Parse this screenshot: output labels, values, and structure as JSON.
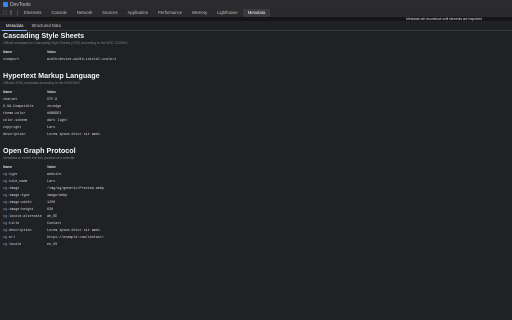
{
  "window": {
    "title": "DevTools"
  },
  "panel_tabs": [
    "Elements",
    "Console",
    "Network",
    "Sources",
    "Application",
    "Performance",
    "Memory",
    "Lighthouse",
    "Metadata"
  ],
  "active_panel_tab": "Metadata",
  "notice": "Metadata will reconstruct until elements are inspected",
  "subtabs": [
    "Metadata",
    "Structured Data"
  ],
  "active_subtab": "Metadata",
  "sections": {
    "css": {
      "title": "Cascading Style Sheets",
      "description": "Official metadata for Cascading Style Sheets (CSS) according to the W3C CSSWG.",
      "headers": [
        "Name",
        "Value"
      ],
      "rows": [
        {
          "name": "viewport",
          "value": "width=device-width,initial-scale=1"
        }
      ]
    },
    "html": {
      "title": "Hypertext Markup Language",
      "description": "Official HTML metadata according to the WHATWG.",
      "headers": [
        "Name",
        "Value"
      ],
      "rows": [
        {
          "name": "charset",
          "value": "UTF-8"
        },
        {
          "name": "X-UA-Compatible",
          "value": "ie=edge"
        },
        {
          "name": "theme-color",
          "value": "#6B8DE3"
        },
        {
          "name": "color-scheme",
          "value": "dark light"
        },
        {
          "name": "copyright",
          "value": "Lars"
        },
        {
          "name": "description",
          "value": "Lorem ipsum dolor sit amet."
        }
      ]
    },
    "og": {
      "title": "Open Graph Protocol",
      "description": "Metadata to enrich the link preview of a website.",
      "headers": [
        "Name",
        "Value"
      ],
      "prefix": "og:",
      "rows": [
        {
          "name": "type",
          "value": "website"
        },
        {
          "name": "site_name",
          "value": "Lars"
        },
        {
          "name": "image",
          "value": "/img/og/generic/Preview.webp"
        },
        {
          "name": "image:type",
          "value": "image/webp"
        },
        {
          "name": "image:width",
          "value": "1200"
        },
        {
          "name": "image:height",
          "value": "630"
        },
        {
          "name": "locale:alternate",
          "value": "de_DE"
        },
        {
          "name": "title",
          "value": "Contact"
        },
        {
          "name": "description",
          "value": "Lorem ipsum dolor sit amet."
        },
        {
          "name": "url",
          "value": "https://example.com/contact/"
        },
        {
          "name": "locale",
          "value": "en_US"
        }
      ]
    }
  }
}
